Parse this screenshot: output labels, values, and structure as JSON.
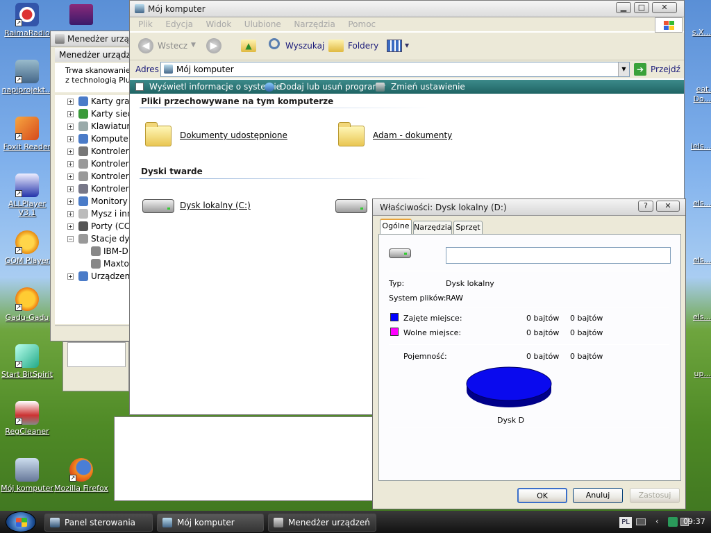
{
  "colors": {
    "used": "#0000ff",
    "free": "#ff00ff",
    "pie": "#0a0aee",
    "taskbar": "#1e1e1e"
  },
  "desktop": {
    "icons": [
      {
        "label": "RaimaRadio",
        "icon": "radio-icon"
      },
      {
        "label": "napiprojekt...",
        "icon": "napiprojekt-icon"
      },
      {
        "label": "Foxit Reader",
        "icon": "foxit-reader-icon"
      },
      {
        "label": "ALLPlayer V3.1",
        "icon": "allplayer-icon"
      },
      {
        "label": "GOM Player",
        "icon": "gom-player-icon"
      },
      {
        "label": "Gadu-Gadu",
        "icon": "gadu-gadu-icon"
      },
      {
        "label": "Start BitSpirit",
        "icon": "bitspirit-icon"
      },
      {
        "label": "RegCleaner",
        "icon": "regcleaner-icon"
      },
      {
        "label": "Mój komputer",
        "icon": "my-computer-icon"
      },
      {
        "label": "Mozilla Firefox",
        "icon": "firefox-icon"
      }
    ],
    "right_clipped": [
      "s.X...",
      "eat.",
      "Do...",
      "iels...",
      "els...",
      "els...",
      "els...",
      "up..."
    ]
  },
  "device_manager": {
    "title": "Menedżer urządzeń",
    "inner_title": "Menedżer urządzeń",
    "scan_text_1": "Trwa skanowanie s",
    "scan_text_2": "z technologią Plug",
    "tree": [
      "Karty graf",
      "Karty siec",
      "Klawiatur",
      "Kompute",
      "Kontroler",
      "Kontroler",
      "Kontroler",
      "Kontroler",
      "Monitory",
      "Mysz i inn",
      "Porty (CC",
      "Stacje dys",
      "IBM-D",
      "Maxto",
      "Urządzen"
    ]
  },
  "explorer": {
    "title": "Mój komputer",
    "menu": [
      "Plik",
      "Edycja",
      "Widok",
      "Ulubione",
      "Narzędzia",
      "Pomoc"
    ],
    "back_label": "Wstecz",
    "search_label": "Wyszukaj",
    "folders_label": "Foldery",
    "address_label": "Adres",
    "address_value": "Mój komputer",
    "go_label": "Przejdź",
    "tasks": [
      "Wyświetl informacje o systemie",
      "Dodaj lub usuń programy",
      "Zmień ustawienie"
    ],
    "section_files": "Pliki przechowywane na tym komputerze",
    "folder1": "Dokumenty udostępnione",
    "folder2": "Adam - dokumenty",
    "section_drives": "Dyski twarde",
    "drive_c": "Dysk lokalny (C:)"
  },
  "properties": {
    "title": "Właściwości: Dysk lokalny (D:)",
    "tabs": [
      "Ogólne",
      "Narzędzia",
      "Sprzęt"
    ],
    "name_value": "",
    "type_label": "Typ:",
    "type_value": "Dysk lokalny",
    "fs_label": "System plików:",
    "fs_value": "RAW",
    "used_label": "Zajęte miejsce:",
    "used_bytes": "0 bajtów",
    "used_size": "0 bajtów",
    "free_label": "Wolne miejsce:",
    "free_bytes": "0 bajtów",
    "free_size": "0 bajtów",
    "capacity_label": "Pojemność:",
    "capacity_bytes": "0 bajtów",
    "capacity_size": "0 bajtów",
    "drive_caption": "Dysk D",
    "ok": "OK",
    "cancel": "Anuluj",
    "apply": "Zastosuj"
  },
  "taskbar": {
    "items": [
      "Panel sterowania",
      "Mój komputer",
      "Menedżer urządzeń"
    ],
    "lang": "PL",
    "time": "09:37"
  }
}
